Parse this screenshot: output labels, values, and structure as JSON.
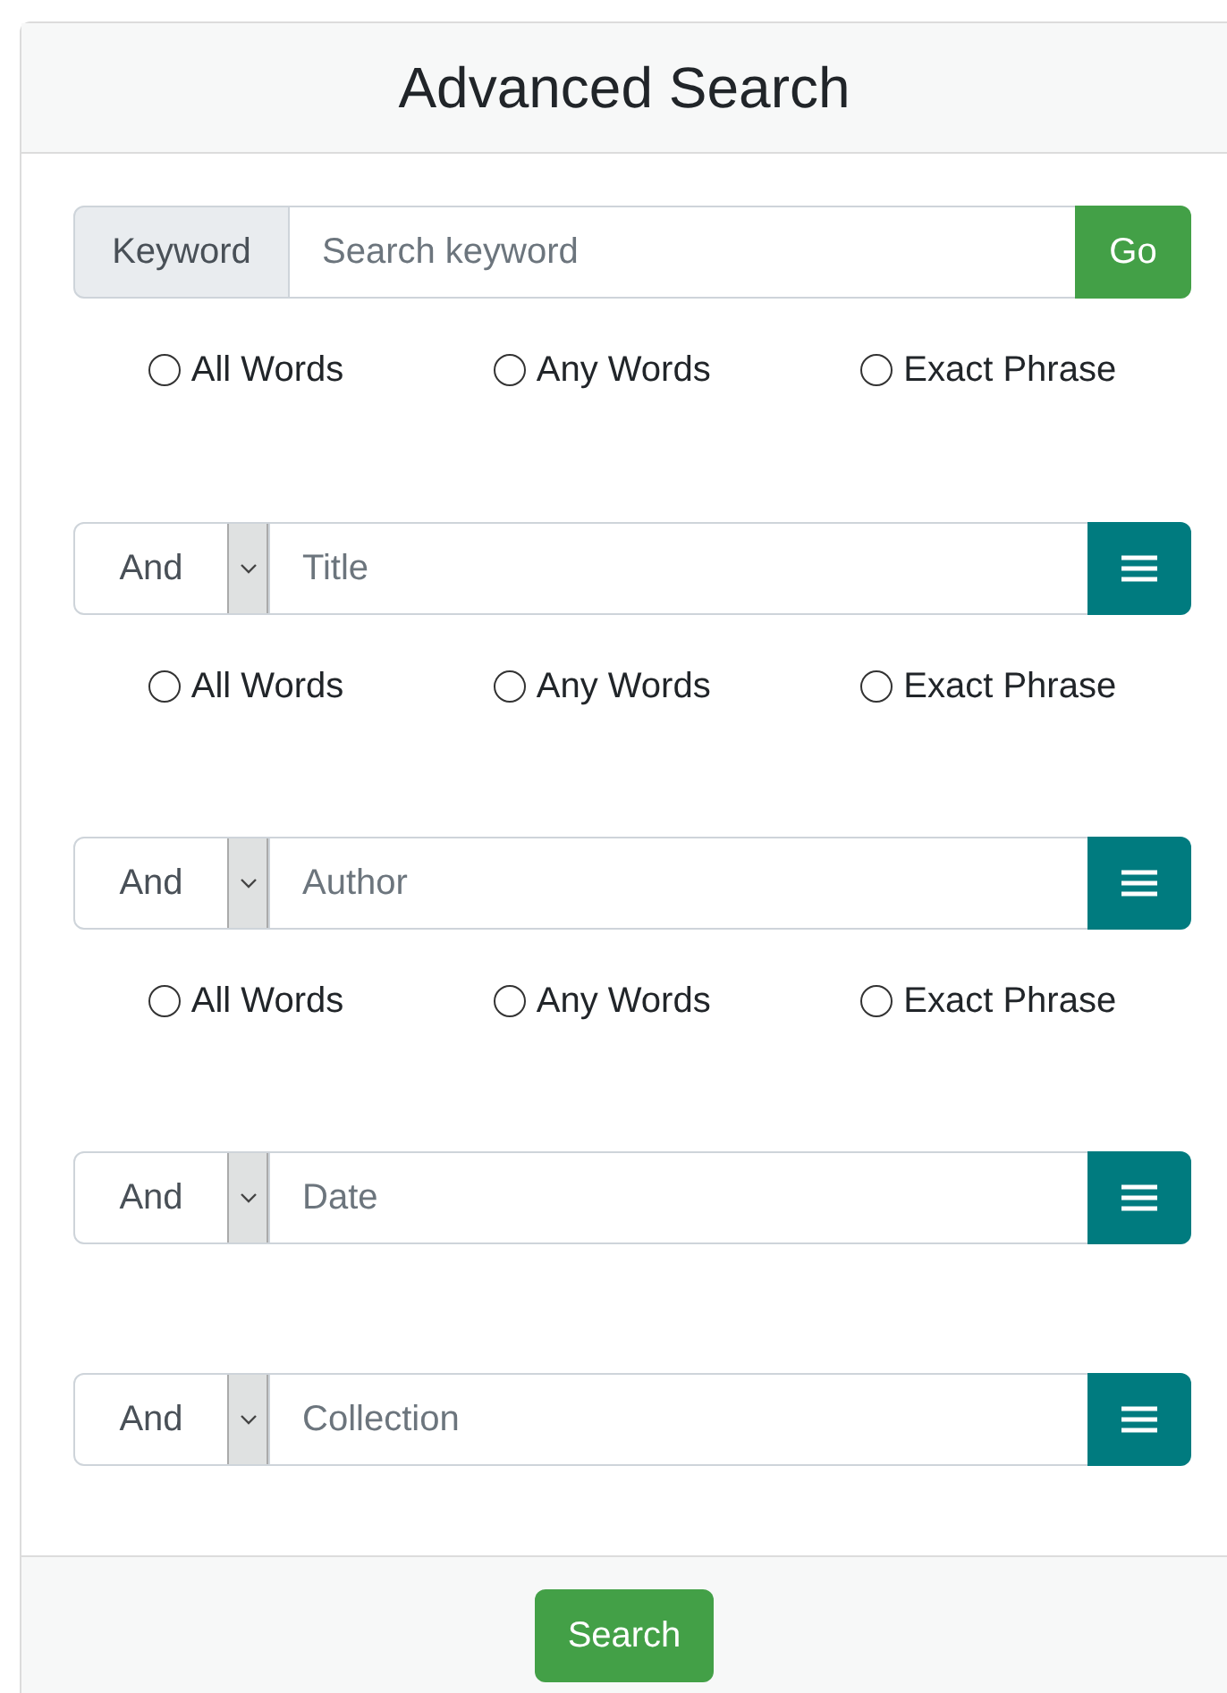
{
  "header": {
    "title": "Advanced Search"
  },
  "keyword": {
    "label": "Keyword",
    "placeholder": "Search keyword",
    "button": "Go",
    "match_options": [
      {
        "label": "All Words",
        "selected": false
      },
      {
        "label": "Any Words",
        "selected": false
      },
      {
        "label": "Exact Phrase",
        "selected": false
      }
    ]
  },
  "criteria": [
    {
      "operator": "And",
      "placeholder": "Title",
      "match_options": [
        {
          "label": "All Words",
          "selected": false
        },
        {
          "label": "Any Words",
          "selected": false
        },
        {
          "label": "Exact Phrase",
          "selected": false
        }
      ]
    },
    {
      "operator": "And",
      "placeholder": "Author",
      "match_options": [
        {
          "label": "All Words",
          "selected": false
        },
        {
          "label": "Any Words",
          "selected": false
        },
        {
          "label": "Exact Phrase",
          "selected": false
        }
      ]
    },
    {
      "operator": "And",
      "placeholder": "Date"
    },
    {
      "operator": "And",
      "placeholder": "Collection"
    }
  ],
  "footer": {
    "button": "Search"
  }
}
